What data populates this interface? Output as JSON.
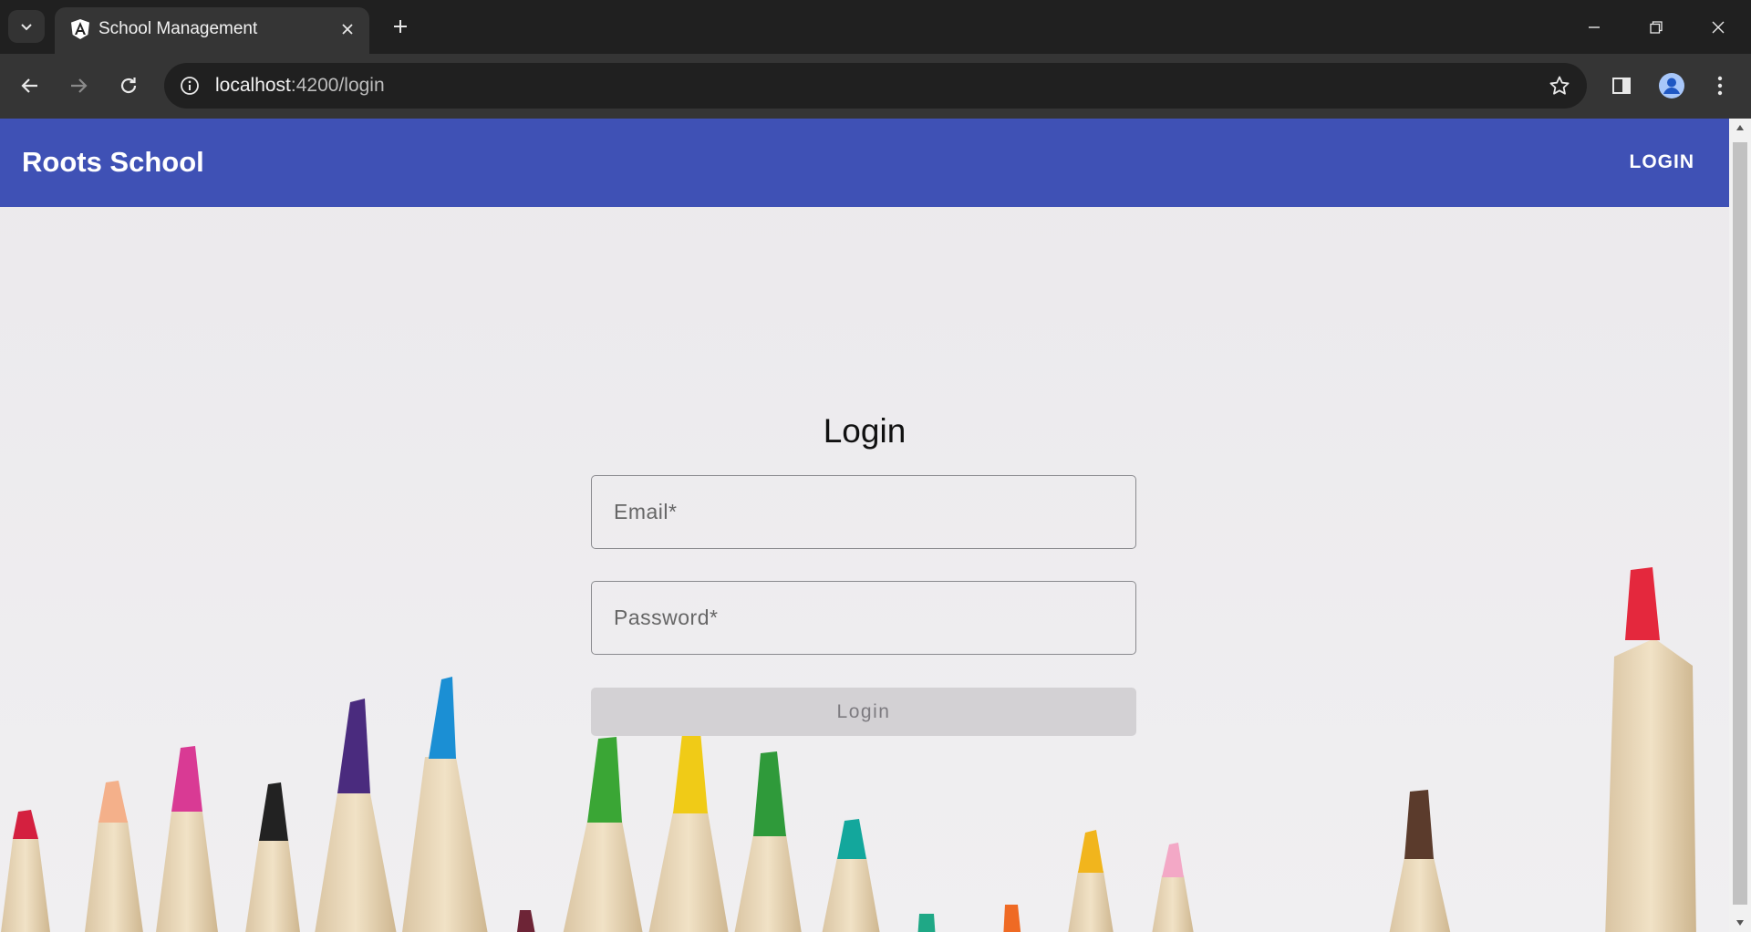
{
  "browser": {
    "tab": {
      "title": "School Management",
      "favicon": "angular-logo-icon"
    },
    "address_bar": {
      "host": "localhost",
      "rest": ":4200/login"
    },
    "icons": [
      "tab-search-icon",
      "close-icon",
      "plus-icon",
      "minimize-icon",
      "restore-icon",
      "close-window-icon",
      "back-icon",
      "forward-icon",
      "reload-icon",
      "site-info-icon",
      "star-icon",
      "side-panel-icon",
      "profile-avatar-icon",
      "more-menu-icon"
    ]
  },
  "app": {
    "brand": "Roots School",
    "nav_login": "LOGIN",
    "header_color": "#3f51b5"
  },
  "login_form": {
    "title": "Login",
    "email_placeholder": "Email*",
    "email_value": "",
    "password_placeholder": "Password*",
    "password_value": "",
    "submit_label": "Login",
    "submit_state": "disabled"
  }
}
